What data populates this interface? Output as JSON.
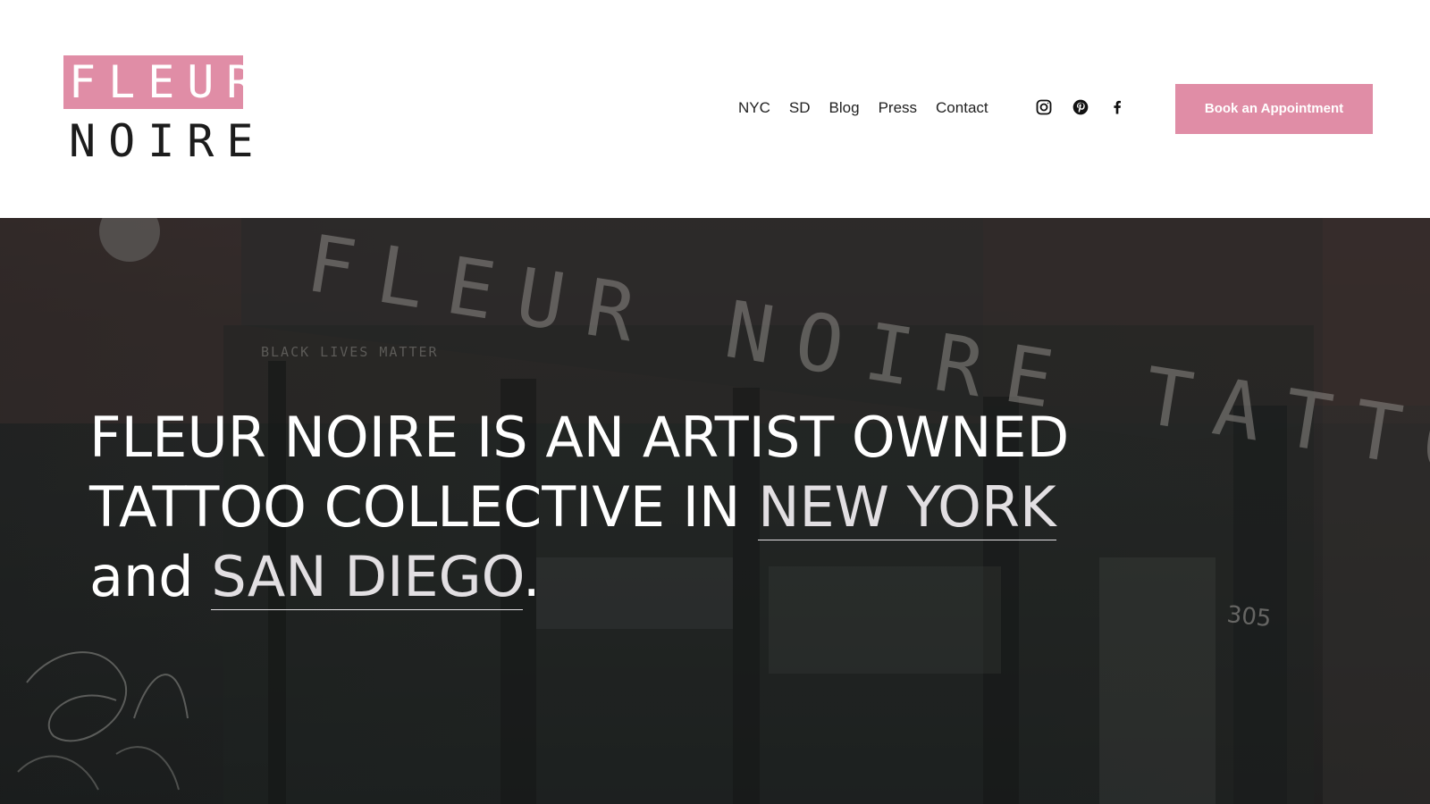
{
  "logo": {
    "top": "FLEUR",
    "bottom": "NOIRE"
  },
  "nav": {
    "items": [
      {
        "label": "NYC"
      },
      {
        "label": "SD"
      },
      {
        "label": "Blog"
      },
      {
        "label": "Press"
      },
      {
        "label": "Contact"
      }
    ]
  },
  "social": {
    "icons": [
      "instagram-icon",
      "pinterest-icon",
      "facebook-icon"
    ]
  },
  "cta": {
    "label": "Book an Appointment"
  },
  "hero": {
    "headline_line1": "FLEUR NOIRE IS AN ARTIST OWNED",
    "headline_line2_prefix": "TATTOO COLLECTIVE IN ",
    "link_new_york": "NEW YORK",
    "headline_and": "and ",
    "link_san_diego": "SAN DIEGO",
    "headline_end": ".",
    "background_sign_text": "FLEUR NOIRE TATTOO",
    "background_window_text": "BLACK LIVES MATTER",
    "background_number": "305"
  },
  "colors": {
    "accent_pink": "#e08da6",
    "header_bg": "#ffffff",
    "text_dark": "#222222",
    "hero_text": "#ffffff",
    "hero_link": "#e2dfe2"
  }
}
